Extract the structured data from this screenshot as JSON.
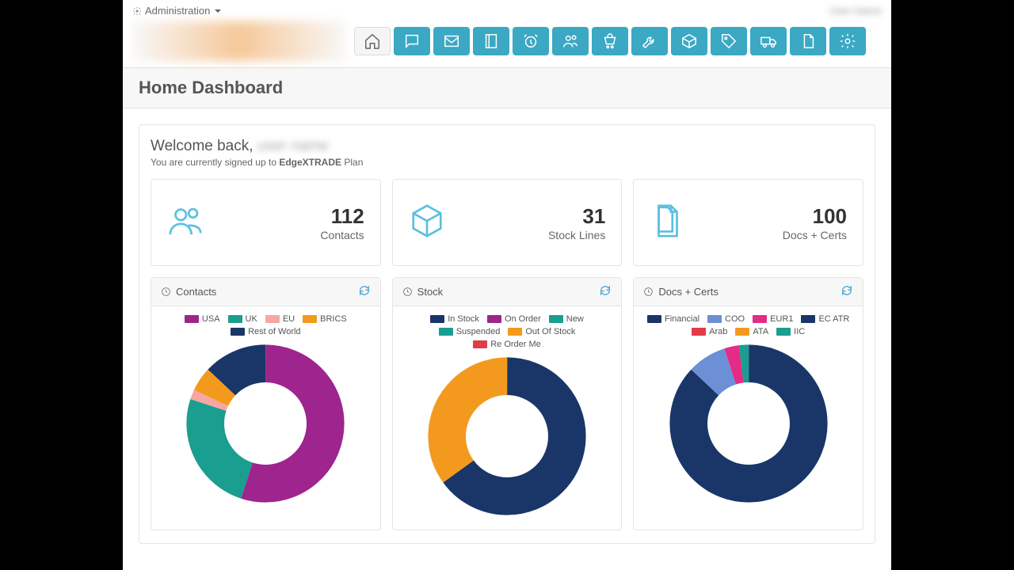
{
  "topbar": {
    "admin_label": "Administration"
  },
  "page_title": "Home Dashboard",
  "welcome": {
    "greeting": "Welcome back, ",
    "sub_prefix": "You are currently signed up to ",
    "plan_name": "EdgeXTRADE",
    "sub_suffix": " Plan"
  },
  "stats": {
    "contacts": {
      "value": "112",
      "label": "Contacts"
    },
    "stock": {
      "value": "31",
      "label": "Stock Lines"
    },
    "docs": {
      "value": "100",
      "label": "Docs + Certs"
    }
  },
  "charts": {
    "contacts": {
      "title": "Contacts"
    },
    "stock": {
      "title": "Stock"
    },
    "docs": {
      "title": "Docs + Certs"
    }
  },
  "legends": {
    "contacts": [
      {
        "label": "USA",
        "color": "#9e258d"
      },
      {
        "label": "UK",
        "color": "#199e8f"
      },
      {
        "label": "EU",
        "color": "#f7a7a2"
      },
      {
        "label": "BRICS",
        "color": "#f39a1e"
      },
      {
        "label": "Rest of World",
        "color": "#1a3668"
      }
    ],
    "stock": [
      {
        "label": "In Stock",
        "color": "#1a3668"
      },
      {
        "label": "On Order",
        "color": "#9e258d"
      },
      {
        "label": "New",
        "color": "#199e8f"
      },
      {
        "label": "Suspended",
        "color": "#199e8f"
      },
      {
        "label": "Out Of Stock",
        "color": "#f39a1e"
      },
      {
        "label": "Re Order Me",
        "color": "#e23b4a"
      }
    ],
    "docs": [
      {
        "label": "Financial",
        "color": "#1a3668"
      },
      {
        "label": "COO",
        "color": "#6d8fd6"
      },
      {
        "label": "EUR1",
        "color": "#e32b87"
      },
      {
        "label": "EC ATR",
        "color": "#1a3668"
      },
      {
        "label": "Arab",
        "color": "#e23b4a"
      },
      {
        "label": "ATA",
        "color": "#f39a1e"
      },
      {
        "label": "IIC",
        "color": "#199e8f"
      }
    ]
  },
  "chart_data": [
    {
      "type": "pie",
      "title": "Contacts",
      "series": [
        {
          "name": "Contacts",
          "values": [
            55,
            25,
            2,
            5,
            13
          ]
        }
      ],
      "categories": [
        "USA",
        "UK",
        "EU",
        "BRICS",
        "Rest of World"
      ],
      "colors": [
        "#9e258d",
        "#199e8f",
        "#f7a7a2",
        "#f39a1e",
        "#1a3668"
      ]
    },
    {
      "type": "pie",
      "title": "Stock",
      "series": [
        {
          "name": "Stock",
          "values": [
            65,
            0,
            0,
            0,
            35,
            0
          ]
        }
      ],
      "categories": [
        "In Stock",
        "On Order",
        "New",
        "Suspended",
        "Out Of Stock",
        "Re Order Me"
      ],
      "colors": [
        "#1a3668",
        "#9e258d",
        "#199e8f",
        "#199e8f",
        "#f39a1e",
        "#e23b4a"
      ]
    },
    {
      "type": "pie",
      "title": "Docs + Certs",
      "series": [
        {
          "name": "Docs",
          "values": [
            87,
            8,
            3,
            0,
            0,
            0,
            2
          ]
        }
      ],
      "categories": [
        "Financial",
        "COO",
        "EUR1",
        "EC ATR",
        "Arab",
        "ATA",
        "IIC"
      ],
      "colors": [
        "#1a3668",
        "#6d8fd6",
        "#e32b87",
        "#1a3668",
        "#e23b4a",
        "#f39a1e",
        "#199e8f"
      ]
    }
  ]
}
